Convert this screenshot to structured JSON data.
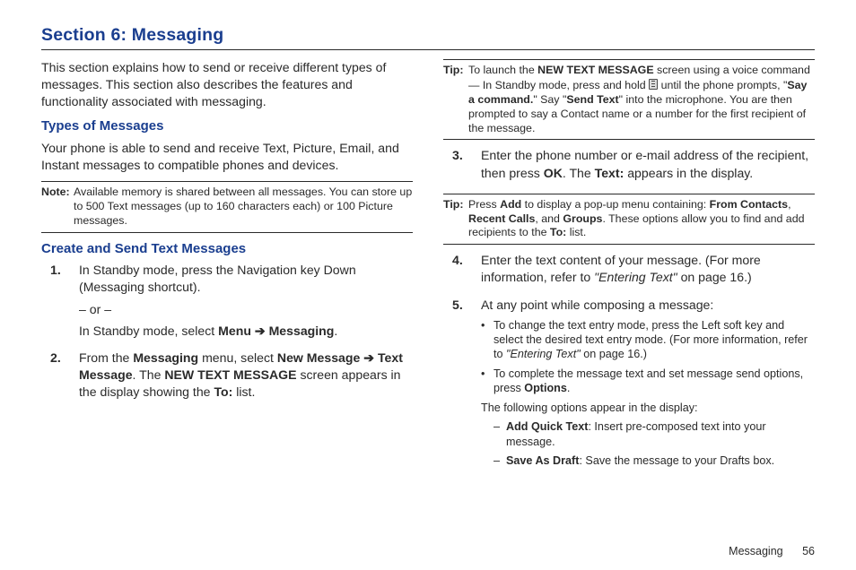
{
  "title": "Section 6: Messaging",
  "left": {
    "intro": "This section explains how to send or receive different types of messages. This section also describes the features and functionality associated with messaging.",
    "h_types": "Types of Messages",
    "types_body": "Your phone is able to send and receive Text, Picture, Email, and Instant messages to compatible phones and devices.",
    "note_label": "Note:",
    "note_body": "Available memory is shared between all messages. You can store up to 500 Text messages (up to 160 characters each) or 100 Picture messages.",
    "h_create": "Create and Send Text Messages",
    "step1": {
      "num": "1.",
      "p1": "In Standby mode, press the Navigation key Down (Messaging shortcut).",
      "or": "– or –",
      "p2_a": "In Standby mode, select ",
      "p2_b": "Menu",
      "p2_c": "Messaging",
      "dot": "."
    },
    "step2": {
      "num": "2.",
      "a": "From the ",
      "b": "Messaging",
      "c": " menu, select ",
      "d": "New Message",
      "e": "Text Message",
      "f": ". The ",
      "g": "NEW TEXT MESSAGE",
      "h": " screen appears in the display showing the ",
      "i": "To:",
      "j": " list."
    }
  },
  "right": {
    "tip1_label": "Tip:",
    "tip1": {
      "a": "To launch the ",
      "b": "NEW TEXT MESSAGE",
      "c": " screen using a voice command — In Standby mode, press and hold ",
      "d": " until the phone prompts, \"",
      "e": "Say a command.",
      "f": "\" Say \"",
      "g": "Send Text",
      "h": "\" into the microphone. You are then prompted to say a Contact name or a number for the first recipient of the message."
    },
    "step3": {
      "num": "3.",
      "a": "Enter the phone number or e-mail address of the recipient, then press ",
      "b": "OK",
      "c": ". The ",
      "d": "Text:",
      "e": " appears in the display."
    },
    "tip2_label": "Tip:",
    "tip2": {
      "a": "Press ",
      "b": "Add",
      "c": " to display a pop-up menu containing: ",
      "d": "From Contacts",
      "e": ", ",
      "f": "Recent Calls",
      "g": ", and ",
      "h": "Groups",
      "i": ". These options allow you to find and add recipients to the ",
      "j": "To:",
      "k": " list."
    },
    "step4": {
      "num": "4.",
      "a": "Enter the text content of your message. (For more information, refer to ",
      "b": "\"Entering Text\"",
      "c": " on page 16.)"
    },
    "step5": {
      "num": "5.",
      "text": "At any point while composing a message:"
    },
    "b1": {
      "a": "To change the text entry mode, press the Left soft key and select the desired text entry mode. (For more information, refer to ",
      "b": "\"Entering Text\"",
      "c": " on page 16.)"
    },
    "b2": {
      "a": "To complete the message text and set message send options, press ",
      "b": "Options",
      "c": "."
    },
    "tail": "The following options appear in the display:",
    "d1": {
      "label": "Add Quick Text",
      "rest": ": Insert pre-composed text into your message."
    },
    "d2": {
      "label": "Save As Draft",
      "rest": ": Save the message to your Drafts box."
    }
  },
  "footer": {
    "label": "Messaging",
    "page": "56"
  }
}
